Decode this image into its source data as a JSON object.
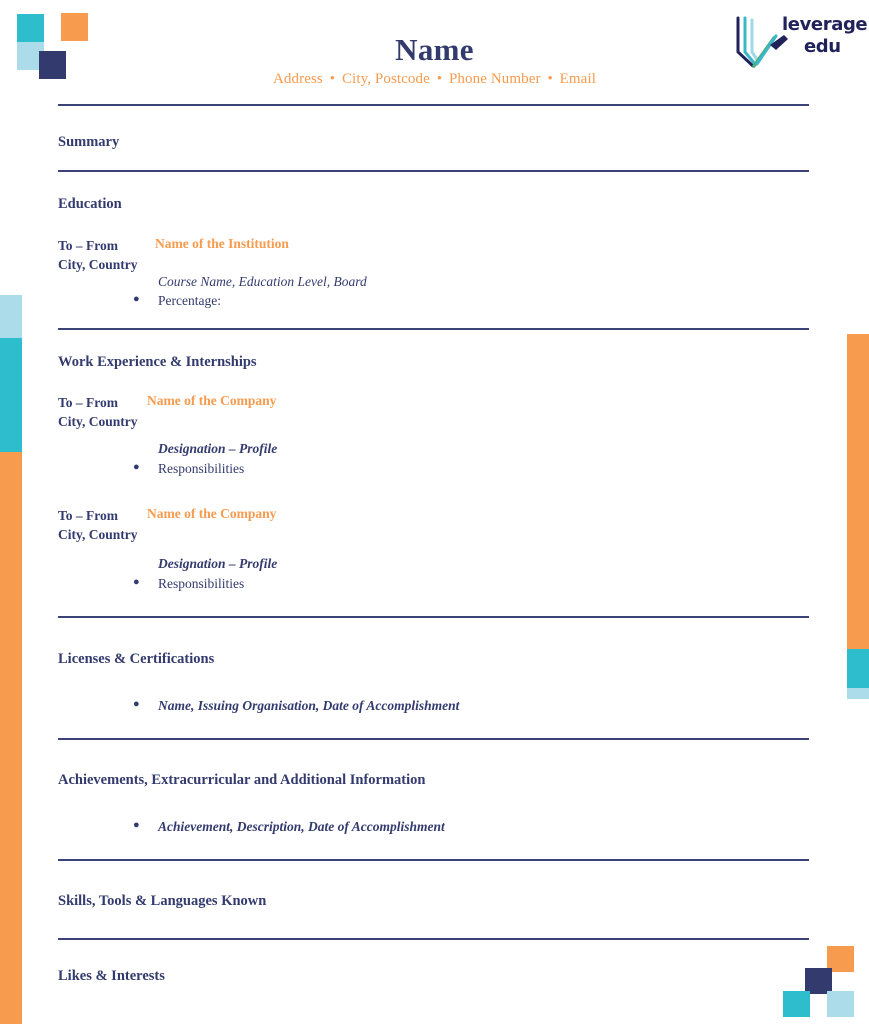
{
  "document": {
    "type": "resume-template",
    "brand": "Leverage Edu"
  },
  "colors": {
    "navy": "#333b6e",
    "navy_rule": "#3b4277",
    "orange": "#f79b4f",
    "teal": "#2ebdcc",
    "light_blue": "#acdcea",
    "logo_navy": "#21225a",
    "logo_teal": "#3bb7c8",
    "logo_green": "#4caf7d",
    "background": "#ffffff"
  },
  "header": {
    "name": "Name",
    "contact": {
      "parts": [
        "Address",
        "City, Postcode",
        "Phone Number",
        "Email"
      ],
      "separator": "•",
      "full": "Address • City, Postcode • Phone Number • Email"
    },
    "logo": {
      "line1": "leverage",
      "line2": "edu",
      "icon": "open-book-pencil-icon"
    }
  },
  "sections": {
    "summary": {
      "heading": "Summary"
    },
    "education": {
      "heading": "Education",
      "entry": {
        "dates": "To – From",
        "location": "City, Country",
        "organisation": "Name of the Institution",
        "subline": "Course Name, Education Level, Board",
        "bullets": [
          "Percentage:"
        ]
      }
    },
    "work": {
      "heading": "Work Experience & Internships",
      "entries": [
        {
          "dates": "To – From",
          "location": "City, Country",
          "organisation": "Name of the Company",
          "subline": "Designation – Profile",
          "bullets": [
            "Responsibilities"
          ]
        },
        {
          "dates": "To – From",
          "location": "City, Country",
          "organisation": "Name of the Company",
          "subline": "Designation – Profile",
          "bullets": [
            "Responsibilities"
          ]
        }
      ]
    },
    "licenses": {
      "heading": "Licenses & Certifications",
      "bullets": [
        "Name, Issuing Organisation, Date of Accomplishment"
      ]
    },
    "achievements": {
      "heading": "Achievements, Extracurricular and Additional Information",
      "bullets": [
        "Achievement, Description, Date of Accomplishment"
      ]
    },
    "skills": {
      "heading": "Skills, Tools & Languages Known"
    },
    "likes": {
      "heading": "Likes & Interests"
    }
  }
}
